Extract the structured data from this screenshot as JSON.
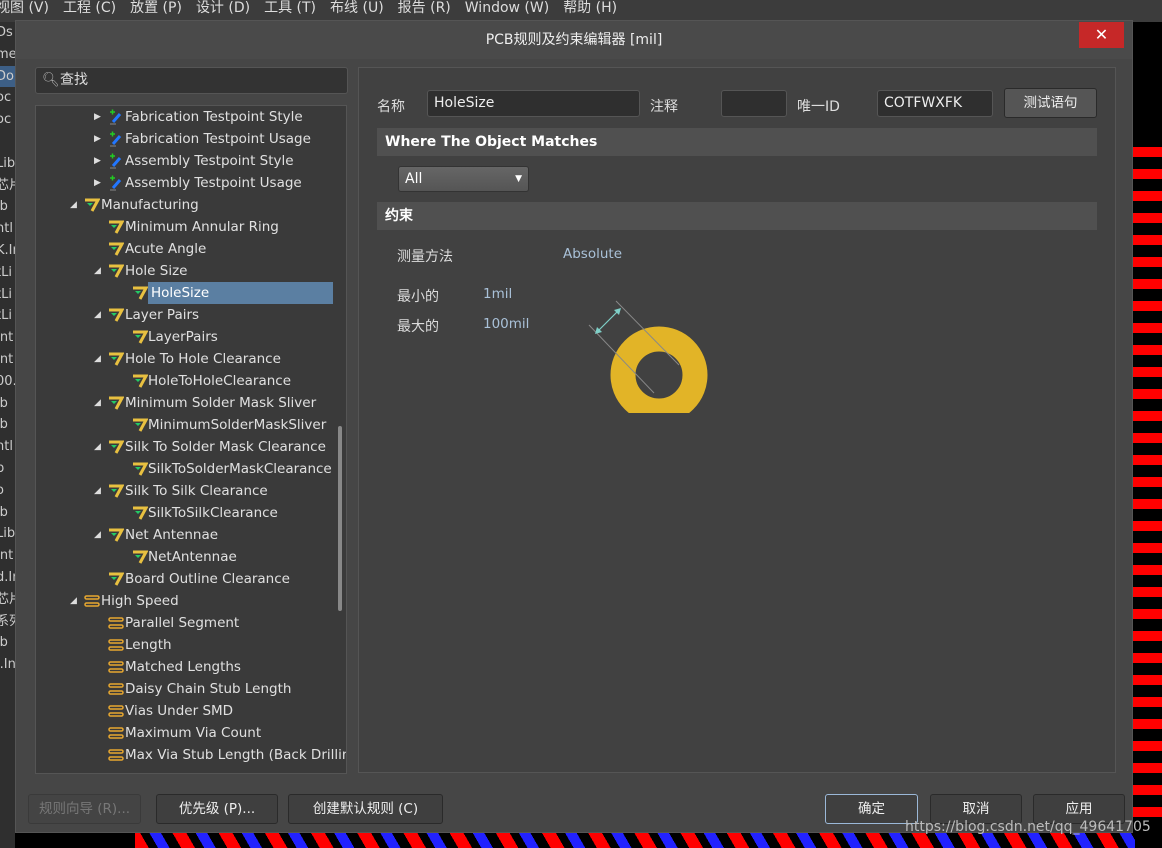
{
  "menubar": [
    "视图 (V)",
    "工程 (C)",
    "放置 (P)",
    "设计 (D)",
    "工具 (T)",
    "布线 (U)",
    "报告 (R)",
    "Window (W)",
    "帮助 (H)"
  ],
  "background_panel_fragments": [
    "Ds",
    "me",
    "Do",
    "oc",
    "oc",
    "",
    "Libr",
    "芯片",
    "ib",
    "ntl",
    "K.In",
    "tLi",
    "tLi",
    "tLi",
    "Int",
    "Int",
    "00.",
    "ib",
    "ib",
    "ntl",
    "b",
    "o",
    "ib",
    "Lib",
    "Int",
    "d.In",
    "芯片",
    "系列",
    "ib",
    "l.Int"
  ],
  "dialog": {
    "title": "PCB规则及约束编辑器 [mil]",
    "close_icon": "close-icon"
  },
  "search": {
    "placeholder": "查找"
  },
  "tree": [
    {
      "label": "Fabrication Testpoint Style",
      "level": 2,
      "expander": "collapsed",
      "icon": "testpoint-icon"
    },
    {
      "label": "Fabrication Testpoint Usage",
      "level": 2,
      "expander": "collapsed",
      "icon": "testpoint-icon"
    },
    {
      "label": "Assembly Testpoint Style",
      "level": 2,
      "expander": "collapsed",
      "icon": "testpoint-icon"
    },
    {
      "label": "Assembly Testpoint Usage",
      "level": 2,
      "expander": "collapsed",
      "icon": "testpoint-icon"
    },
    {
      "label": "Manufacturing",
      "level": 1,
      "expander": "expanded",
      "icon": "manufacturing-icon"
    },
    {
      "label": "Minimum Annular Ring",
      "level": 2,
      "expander": "none",
      "icon": "manufacturing-icon"
    },
    {
      "label": "Acute Angle",
      "level": 2,
      "expander": "none",
      "icon": "manufacturing-icon"
    },
    {
      "label": "Hole Size",
      "level": 2,
      "expander": "expanded",
      "icon": "manufacturing-icon"
    },
    {
      "label": "HoleSize",
      "level": 3,
      "expander": "none",
      "icon": "manufacturing-icon",
      "selected": true
    },
    {
      "label": "Layer Pairs",
      "level": 2,
      "expander": "expanded",
      "icon": "manufacturing-icon"
    },
    {
      "label": "LayerPairs",
      "level": 3,
      "expander": "none",
      "icon": "manufacturing-icon"
    },
    {
      "label": "Hole To Hole Clearance",
      "level": 2,
      "expander": "expanded",
      "icon": "manufacturing-icon"
    },
    {
      "label": "HoleToHoleClearance",
      "level": 3,
      "expander": "none",
      "icon": "manufacturing-icon"
    },
    {
      "label": "Minimum Solder Mask Sliver",
      "level": 2,
      "expander": "expanded",
      "icon": "manufacturing-icon"
    },
    {
      "label": "MinimumSolderMaskSliver",
      "level": 3,
      "expander": "none",
      "icon": "manufacturing-icon"
    },
    {
      "label": "Silk To Solder Mask Clearance",
      "level": 2,
      "expander": "expanded",
      "icon": "manufacturing-icon"
    },
    {
      "label": "SilkToSolderMaskClearance",
      "level": 3,
      "expander": "none",
      "icon": "manufacturing-icon"
    },
    {
      "label": "Silk To Silk Clearance",
      "level": 2,
      "expander": "expanded",
      "icon": "manufacturing-icon"
    },
    {
      "label": "SilkToSilkClearance",
      "level": 3,
      "expander": "none",
      "icon": "manufacturing-icon"
    },
    {
      "label": "Net Antennae",
      "level": 2,
      "expander": "expanded",
      "icon": "manufacturing-icon"
    },
    {
      "label": "NetAntennae",
      "level": 3,
      "expander": "none",
      "icon": "manufacturing-icon"
    },
    {
      "label": "Board Outline Clearance",
      "level": 2,
      "expander": "none",
      "icon": "manufacturing-icon"
    },
    {
      "label": "High Speed",
      "level": 1,
      "expander": "expanded",
      "icon": "high-speed-icon"
    },
    {
      "label": "Parallel Segment",
      "level": 2,
      "expander": "none",
      "icon": "high-speed-icon"
    },
    {
      "label": "Length",
      "level": 2,
      "expander": "none",
      "icon": "high-speed-icon"
    },
    {
      "label": "Matched Lengths",
      "level": 2,
      "expander": "none",
      "icon": "high-speed-icon"
    },
    {
      "label": "Daisy Chain Stub Length",
      "level": 2,
      "expander": "none",
      "icon": "high-speed-icon"
    },
    {
      "label": "Vias Under SMD",
      "level": 2,
      "expander": "none",
      "icon": "high-speed-icon"
    },
    {
      "label": "Maximum Via Count",
      "level": 2,
      "expander": "none",
      "icon": "high-speed-icon"
    },
    {
      "label": "Max Via Stub Length (Back Drilling)",
      "level": 2,
      "expander": "none",
      "icon": "high-speed-icon"
    }
  ],
  "rule": {
    "name_label": "名称",
    "name_value": "HoleSize",
    "comment_label": "注释",
    "comment_value": "",
    "id_label": "唯一ID",
    "id_value": "COTFWXFK",
    "test_button": "测试语句",
    "where_header": "Where The Object Matches",
    "match_select": "All",
    "constraints_header": "约束",
    "measure_label": "测量方法",
    "measure_value": "Absolute",
    "min_label": "最小的",
    "min_value": "1mil",
    "max_label": "最大的",
    "max_value": "100mil",
    "pad_color": "#e2b427"
  },
  "buttons": {
    "wizard": "规则向导 (R)...",
    "priority": "优先级 (P)...",
    "create_default": "创建默认规则 (C)",
    "ok": "确定",
    "cancel": "取消",
    "apply": "应用"
  },
  "watermark": "https://blog.csdn.net/qq_49641705"
}
